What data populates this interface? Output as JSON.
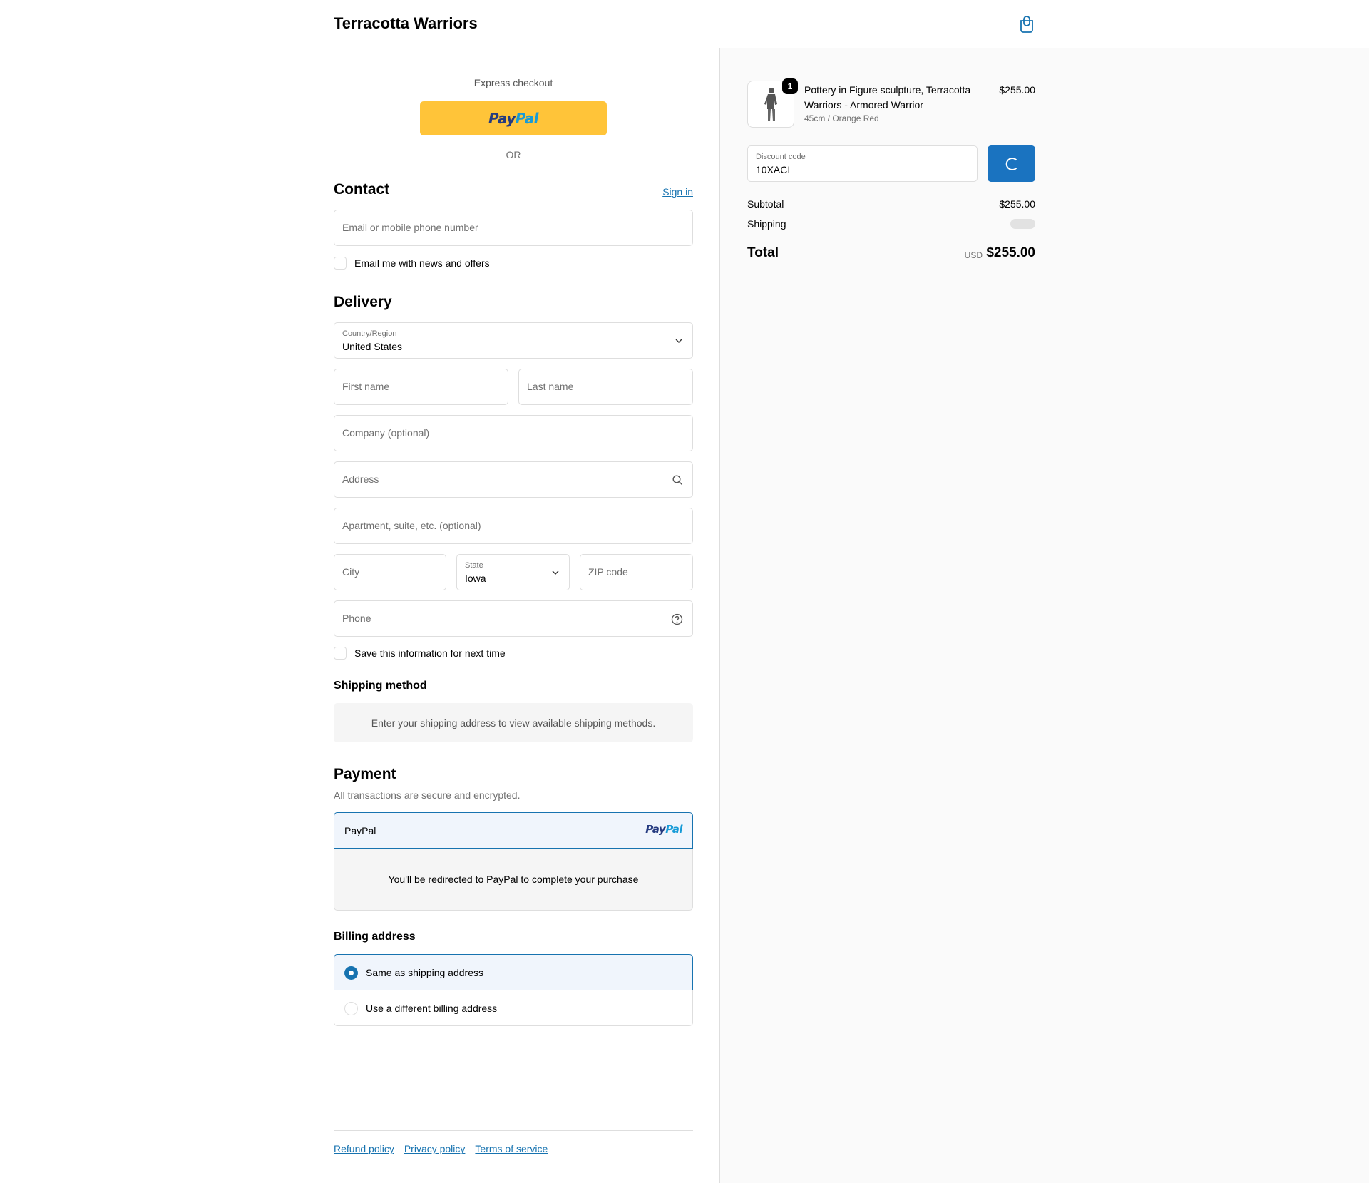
{
  "header": {
    "shop_name": "Terracotta Warriors",
    "cart_icon": "shopping-bag-icon"
  },
  "express": {
    "label": "Express checkout",
    "paypal_logo_part1": "Pay",
    "paypal_logo_part2": "Pal",
    "or_text": "OR"
  },
  "contact": {
    "title": "Contact",
    "sign_in": "Sign in",
    "email_placeholder": "Email or mobile phone number",
    "news_checkbox_label": "Email me with news and offers"
  },
  "delivery": {
    "title": "Delivery",
    "country_label": "Country/Region",
    "country_value": "United States",
    "first_name_placeholder": "First name",
    "last_name_placeholder": "Last name",
    "company_placeholder": "Company (optional)",
    "address_placeholder": "Address",
    "apartment_placeholder": "Apartment, suite, etc. (optional)",
    "city_placeholder": "City",
    "state_label": "State",
    "state_value": "Iowa",
    "zip_placeholder": "ZIP code",
    "phone_placeholder": "Phone",
    "save_info_label": "Save this information for next time"
  },
  "shipping_method": {
    "title": "Shipping method",
    "message": "Enter your shipping address to view available shipping methods."
  },
  "payment": {
    "title": "Payment",
    "note": "All transactions are secure and encrypted.",
    "method_label": "PayPal",
    "redirect_message": "You'll be redirected to PayPal to complete your purchase"
  },
  "billing": {
    "title": "Billing address",
    "option_same": "Same as shipping address",
    "option_different": "Use a different billing address",
    "selected": "same"
  },
  "footer": {
    "links": [
      "Refund policy",
      "Privacy policy",
      "Terms of service"
    ]
  },
  "summary": {
    "product_name": "Pottery in Figure sculpture, Terracotta Warriors - Armored Warrior",
    "product_variant": "45cm / Orange Red",
    "product_price": "$255.00",
    "quantity": "1",
    "discount_label": "Discount code",
    "discount_value": "10XACI",
    "subtotal_label": "Subtotal",
    "subtotal_value": "$255.00",
    "shipping_label": "Shipping",
    "total_label": "Total",
    "total_currency": "USD",
    "total_value": "$255.00"
  },
  "colors": {
    "accent": "#1773b0",
    "paypal_yellow": "#ffc439",
    "apply_button": "#1a73c0"
  }
}
